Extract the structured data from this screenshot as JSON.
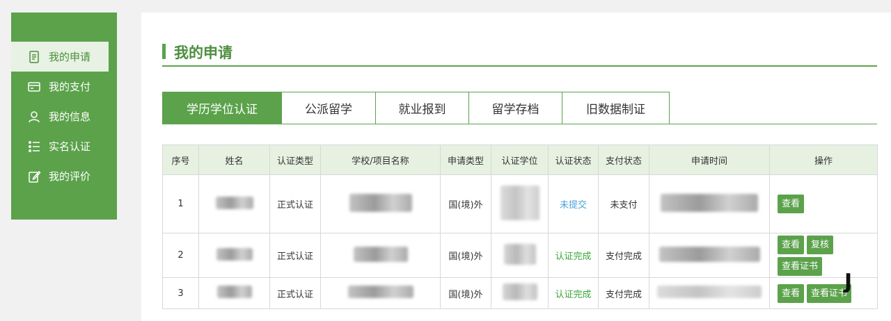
{
  "sidebar": {
    "items": [
      {
        "label": "我的申请",
        "icon": "document-icon",
        "active": true
      },
      {
        "label": "我的支付",
        "icon": "card-icon",
        "active": false
      },
      {
        "label": "我的信息",
        "icon": "user-icon",
        "active": false
      },
      {
        "label": "实名认证",
        "icon": "list-icon",
        "active": false
      },
      {
        "label": "我的评价",
        "icon": "edit-icon",
        "active": false
      }
    ]
  },
  "page": {
    "title": "我的申请"
  },
  "tabs": [
    {
      "label": "学历学位认证",
      "active": true
    },
    {
      "label": "公派留学",
      "active": false
    },
    {
      "label": "就业报到",
      "active": false
    },
    {
      "label": "留学存档",
      "active": false
    },
    {
      "label": "旧数据制证",
      "active": false
    }
  ],
  "table": {
    "headers": [
      "序号",
      "姓名",
      "认证类型",
      "学校/项目名称",
      "申请类型",
      "认证学位",
      "认证状态",
      "支付状态",
      "申请时间",
      "操作"
    ],
    "rows": [
      {
        "no": "1",
        "type": "正式认证",
        "apply_type": "国(境)外",
        "status": "未提交",
        "pay": "未支付",
        "actions": [
          "查看"
        ]
      },
      {
        "no": "2",
        "type": "正式认证",
        "apply_type": "国(境)外",
        "status": "认证完成",
        "pay": "支付完成",
        "actions": [
          "查看",
          "复核",
          "查看证书"
        ]
      },
      {
        "no": "3",
        "type": "正式认证",
        "apply_type": "国(境)外",
        "status": "认证完成",
        "pay": "支付完成",
        "actions": [
          "查看",
          "查看证书"
        ]
      }
    ]
  },
  "colors": {
    "primary": "#5ba24b",
    "pending": "#4aa3d8",
    "done": "#3aa53a"
  },
  "watermark": "J"
}
